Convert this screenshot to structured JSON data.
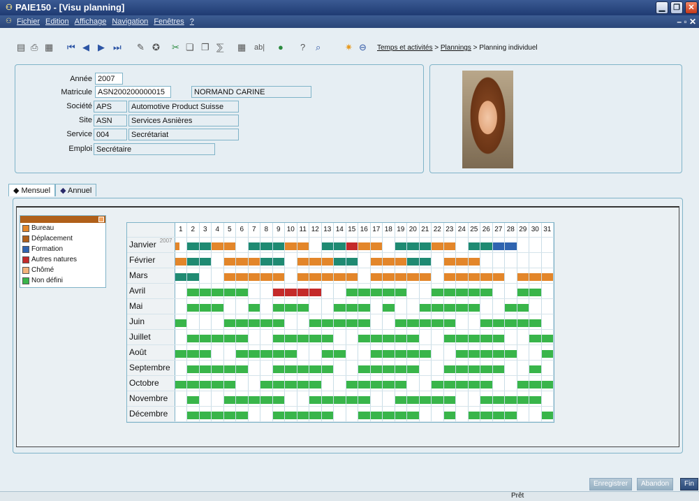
{
  "window": {
    "title": "PAIE150 - [Visu planning]"
  },
  "menu": {
    "items": [
      "Fichier",
      "Edition",
      "Affichage",
      "Navigation",
      "Fenêtres",
      "?"
    ]
  },
  "breadcrumb": {
    "part1": "Temps et activités",
    "sep": " > ",
    "part2": "Plannings",
    "part3": "Planning individuel"
  },
  "employee": {
    "annee_label": "Année",
    "annee": "2007",
    "matricule_label": "Matricule",
    "matricule": "ASN200200000015",
    "nom": "NORMAND CARINE",
    "societe_label": "Société",
    "societe_code": "APS",
    "societe_name": "Automotive Product Suisse",
    "site_label": "Site",
    "site_code": "ASN",
    "site_name": "Services Asnières",
    "service_label": "Service",
    "service_code": "004",
    "service_name": "Secrétariat",
    "emploi_label": "Emploi",
    "emploi": "Secrétaire"
  },
  "tabs": [
    {
      "label": "Mensuel"
    },
    {
      "label": "Annuel"
    }
  ],
  "legend": [
    {
      "code": "B",
      "label": "Bureau",
      "color": "#e3862a"
    },
    {
      "code": "D",
      "label": "Déplacement",
      "color": "#b0601a"
    },
    {
      "code": "F",
      "label": "Formation",
      "color": "#2f64b0"
    },
    {
      "code": "A",
      "label": "Autres natures",
      "color": "#c42a2a"
    },
    {
      "code": "C",
      "label": "Chômé",
      "color": "#f4b27a"
    },
    {
      "code": "N",
      "label": "Non défini",
      "color": "#39b54a"
    }
  ],
  "colors": {
    "T": "#1f8a72",
    "B": "#e3862a",
    "A": "#c42a2a",
    "F": "#2f64b0",
    "N": "#39b54a"
  },
  "planning": {
    "year_marker": "2007",
    "days": [
      "1",
      "2",
      "3",
      "4",
      "5",
      "6",
      "7",
      "8",
      "9",
      "10",
      "11",
      "12",
      "13",
      "14",
      "15",
      "16",
      "17",
      "18",
      "19",
      "20",
      "21",
      "22",
      "23",
      "24",
      "25",
      "26",
      "27",
      "28",
      "29",
      "30",
      "31"
    ],
    "months": [
      {
        "name": "Janvier",
        "days": "PTTBB.TTTBB.TTABB.TTTBB.TTFF"
      },
      {
        "name": "Février",
        "days": "BTT.BBBTT.BBBTT.BBBTT.BBB"
      },
      {
        "name": "Mars",
        "days": "TT..BBBBB.BBBBB.BBBBB.BBBBB.BBBBB"
      },
      {
        "name": "Avril",
        "days": ".NNNNN..AAAA..NNNNN..NNNNN..NN"
      },
      {
        "name": "Mai",
        "days": ".NNN..N.NNN..NNN.N..NNNNN..NN"
      },
      {
        "name": "Juin",
        "days": "N...NNNNN..NNNNN..NNNNN..NNNNN"
      },
      {
        "name": "Juillet",
        "days": ".NNNNN..NNNNN..NNNNN..NNNNN..NN"
      },
      {
        "name": "Août",
        "days": "NNN..NNNNN..NN..NNNNN..NNNNN..NN"
      },
      {
        "name": "Septembre",
        "days": ".NNNNN..NNNNN..NNNNN..NNNNN..N"
      },
      {
        "name": "Octobre",
        "days": "NNNNN..NNNNN..NNNNN..NNNNN..NNN"
      },
      {
        "name": "Novembre",
        "days": ".N..NNNNN..NNNNN..NNNNN..NNNNN"
      },
      {
        "name": "Décembre",
        "days": ".NNNNN..NNNNN..NNNNN..N.NNNN..N"
      }
    ]
  },
  "buttons": {
    "enregistrer": "Enregistrer",
    "abandon": "Abandon",
    "fin": "Fin"
  },
  "status": {
    "text": "Prêt"
  }
}
